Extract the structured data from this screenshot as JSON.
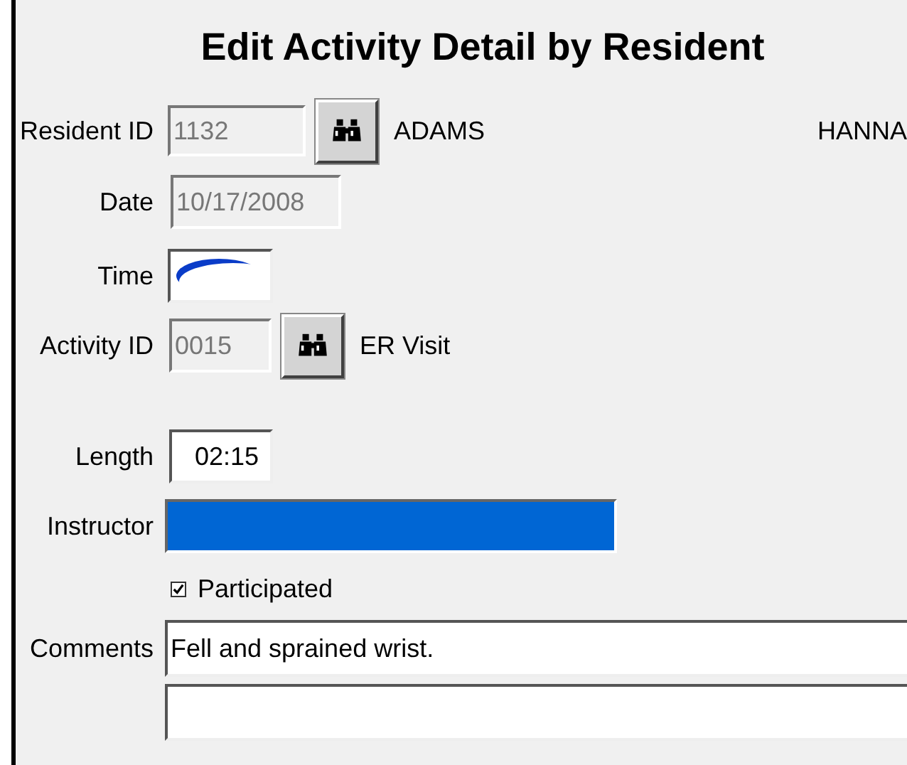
{
  "title": "Edit Activity Detail by Resident",
  "resident": {
    "label": "Resident ID",
    "value": "1132",
    "disabled": true,
    "last_name": "ADAMS",
    "first_name": "HANNA"
  },
  "date": {
    "label": "Date",
    "value": "10/17/2008",
    "disabled": true
  },
  "time": {
    "label": "Time"
  },
  "activity": {
    "label": "Activity ID",
    "value": "0015",
    "disabled": true,
    "name": "ER Visit"
  },
  "length": {
    "label": "Length",
    "value": "02:15"
  },
  "instructor": {
    "label": "Instructor",
    "selected": true
  },
  "participated": {
    "label": "Participated",
    "checked": true
  },
  "comments": {
    "label": "Comments",
    "value": "Fell and sprained wrist."
  }
}
